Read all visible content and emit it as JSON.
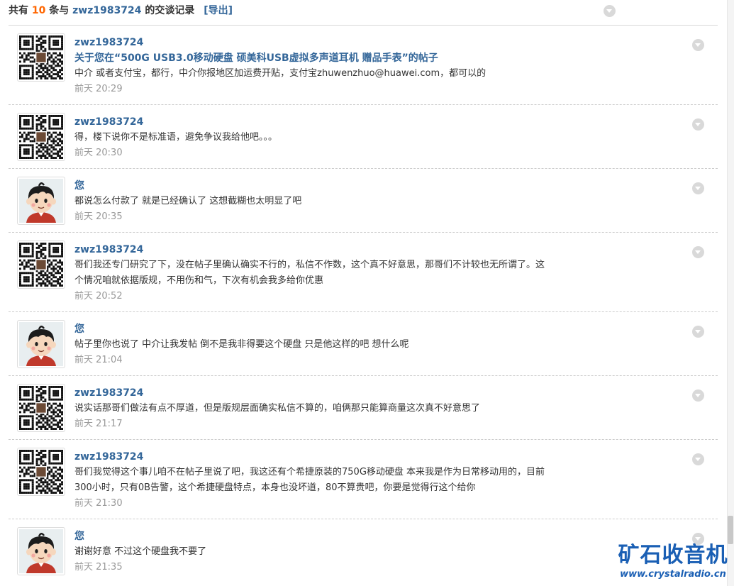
{
  "header": {
    "prefix": "共有",
    "count": "10",
    "middle": "条与",
    "peer": "zwz1983724",
    "suffix": "的交谈记录",
    "export_label": "[导出]"
  },
  "messages": [
    {
      "author": "zwz1983724",
      "avatar": "qr-code-avatar",
      "subject": "关于您在“500G USB3.0移动硬盘 硕美科USB虚拟多声道耳机 赠品手表”的帖子",
      "lines": [
        "中介 或者支付宝，都行，中介你报地区加运费开贴，支付宝zhuwenzhuo@huawei.com，都可以的"
      ],
      "time": "前天 20:29"
    },
    {
      "author": "zwz1983724",
      "avatar": "qr-code-avatar",
      "lines": [
        "得，楼下说你不是标准语，避免争议我给他吧。。。"
      ],
      "time": "前天 20:30"
    },
    {
      "author": "您",
      "avatar": "cartoon-boy-avatar",
      "lines": [
        "都说怎么付款了 就是已经确认了 这想截糊也太明显了吧"
      ],
      "time": "前天 20:35"
    },
    {
      "author": "zwz1983724",
      "avatar": "qr-code-avatar",
      "lines": [
        "哥们我还专门研究了下，没在帖子里确认确实不行的，私信不作数，这个真不好意思，那哥们不计较也无所谓了。这",
        "个情况咱就依据版规，不用伤和气，下次有机会我多给你优惠"
      ],
      "time": "前天 20:52"
    },
    {
      "author": "您",
      "avatar": "cartoon-boy-avatar",
      "lines": [
        "帖子里你也说了  中介让我发帖  倒不是我非得要这个硬盘 只是他这样的吧 想什么呢"
      ],
      "time": "前天 21:04"
    },
    {
      "author": "zwz1983724",
      "avatar": "qr-code-avatar",
      "lines": [
        "说实话那哥们做法有点不厚道，但是版规层面确实私信不算的，咱俩那只能算商量这次真不好意思了"
      ],
      "time": "前天 21:17"
    },
    {
      "author": "zwz1983724",
      "avatar": "qr-code-avatar",
      "lines": [
        "哥们我觉得这个事儿咱不在帖子里说了吧，我这还有个希捷原装的750G移动硬盘 本来我是作为日常移动用的，目前",
        "300小时，只有0B告警，这个希捷硬盘特点，本身也没坏道，80不算贵吧，你要是觉得行这个给你"
      ],
      "time": "前天 21:30"
    },
    {
      "author": "您",
      "avatar": "cartoon-boy-avatar",
      "lines": [
        "谢谢好意 不过这个硬盘我不要了"
      ],
      "time": "前天 21:35"
    }
  ],
  "watermark": {
    "title": "矿石收音机",
    "url": "www.crystalradio.cn"
  },
  "colors": {
    "link": "#336699",
    "count": "#ff6600",
    "time": "#999999",
    "watermark": "#1a5fb4"
  }
}
